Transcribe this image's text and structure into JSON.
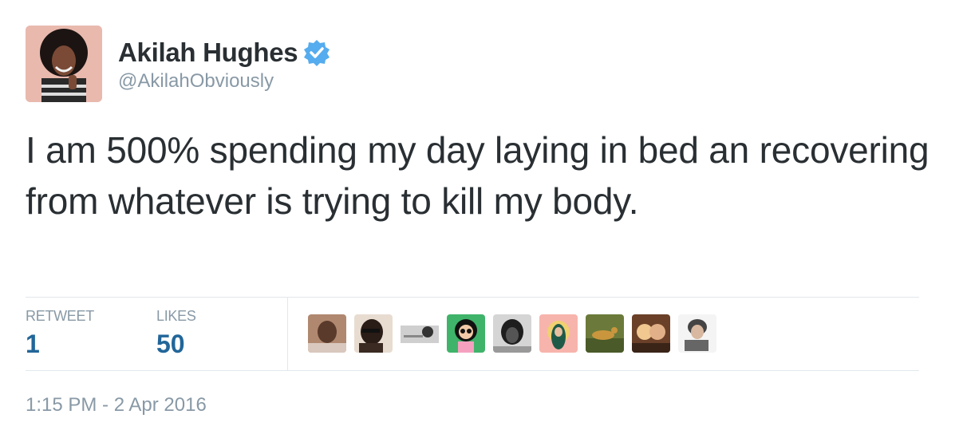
{
  "author": {
    "display_name": "Akilah Hughes",
    "handle": "@AkilahObviously",
    "verified": true,
    "avatar_icon": "profile-photo"
  },
  "tweet": {
    "text": "I am 500% spending my day laying in bed an recovering from whatever is trying to kill my body."
  },
  "stats": {
    "retweet_label": "RETWEET",
    "retweet_count": "1",
    "likes_label": "LIKES",
    "likes_count": "50"
  },
  "likers": [
    {
      "icon": "liker-avatar-1",
      "color": "#9a6a55"
    },
    {
      "icon": "liker-avatar-2",
      "color": "#3a2a22"
    },
    {
      "icon": "liker-avatar-3",
      "color": "#d8d8d8"
    },
    {
      "icon": "liker-avatar-4",
      "color": "#3fb36a"
    },
    {
      "icon": "liker-avatar-5",
      "color": "#6b6b6b"
    },
    {
      "icon": "liker-avatar-6",
      "color": "#f0a5a0"
    },
    {
      "icon": "liker-avatar-7",
      "color": "#6b7a3a"
    },
    {
      "icon": "liker-avatar-8",
      "color": "#8a5a3a"
    },
    {
      "icon": "liker-avatar-9",
      "color": "#bfbfbf"
    }
  ],
  "timestamp": "1:15 PM - 2 Apr 2016",
  "colors": {
    "verified": "#55acee",
    "stat_value": "#226699",
    "muted": "#8899a6",
    "text": "#292f33"
  }
}
